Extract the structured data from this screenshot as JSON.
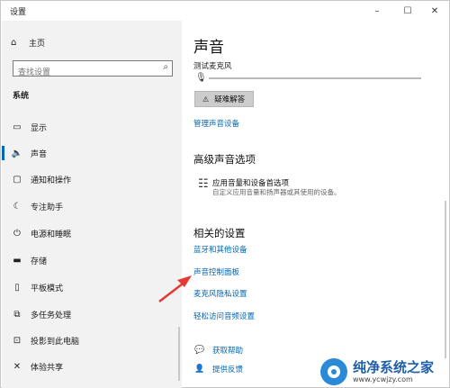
{
  "window": {
    "title": "设置",
    "buttons": {
      "minimize": "–",
      "maximize": "☐",
      "close": "✕"
    }
  },
  "sidebar": {
    "home": "主页",
    "search_placeholder": "查找设置",
    "section": "系统",
    "items": [
      {
        "label": "显示",
        "icon": "monitor-icon",
        "glyph": "▭",
        "active": false
      },
      {
        "label": "声音",
        "icon": "speaker-icon",
        "glyph": "🔈",
        "active": true
      },
      {
        "label": "通知和操作",
        "icon": "notification-icon",
        "glyph": "▢",
        "active": false
      },
      {
        "label": "专注助手",
        "icon": "moon-icon",
        "glyph": "☾",
        "active": false
      },
      {
        "label": "电源和睡眠",
        "icon": "power-icon",
        "glyph": "⏻",
        "active": false
      },
      {
        "label": "存储",
        "icon": "storage-icon",
        "glyph": "▬",
        "active": false
      },
      {
        "label": "平板模式",
        "icon": "tablet-icon",
        "glyph": "▯",
        "active": false
      },
      {
        "label": "多任务处理",
        "icon": "multitask-icon",
        "glyph": "⧉",
        "active": false
      },
      {
        "label": "投影到此电脑",
        "icon": "project-icon",
        "glyph": "⊡",
        "active": false
      },
      {
        "label": "体验共享",
        "icon": "share-icon",
        "glyph": "✕",
        "active": false
      }
    ]
  },
  "content": {
    "title": "声音",
    "mic_label": "测试麦克风",
    "troubleshoot": "疑难解答",
    "manage_devices": "管理声音设备",
    "advanced_title": "高级声音选项",
    "app_volume_title": "应用音量和设备首选项",
    "app_volume_desc": "自定义应用音量和扬声器或其使用的设备。",
    "related_title": "相关的设置",
    "related_links": [
      "蓝牙和其他设备",
      "声音控制面板",
      "麦克风隐私设置",
      "轻松访问音频设置"
    ],
    "help": "获取帮助",
    "feedback": "提供反馈"
  },
  "watermark": {
    "name": "纯净系统之家",
    "url": "www.ycwjzy.com"
  },
  "colors": {
    "accent": "#0067c0",
    "link": "#0066b4",
    "arrow": "#e53935"
  }
}
